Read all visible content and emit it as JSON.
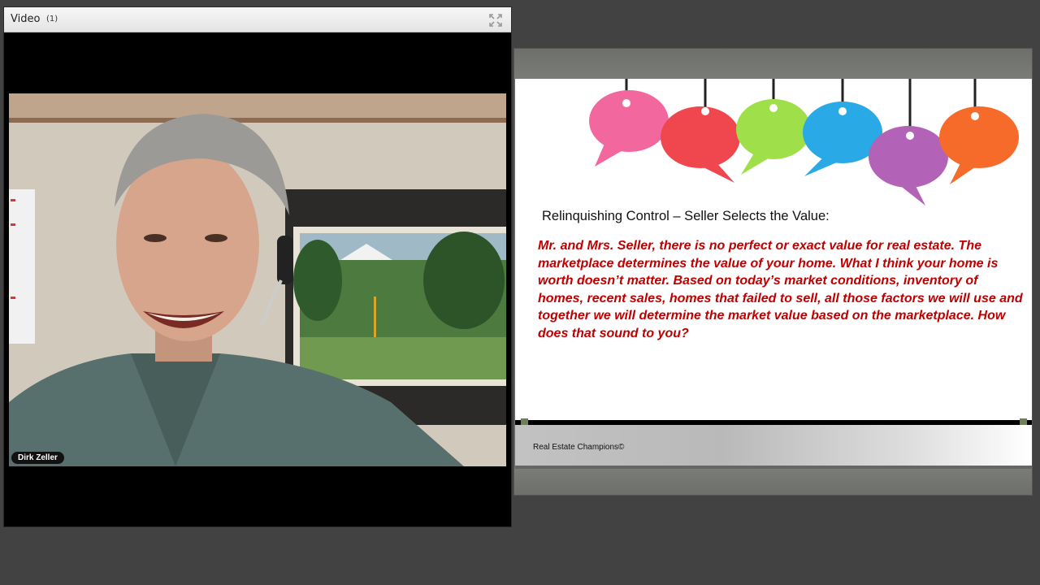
{
  "colors": {
    "background": "#424242",
    "slide_text": "#c00000"
  },
  "video_pod": {
    "title": "Video",
    "count": "(1)",
    "fullscreen_icon": "fullscreen-icon",
    "participant_name": "Dirk Zeller"
  },
  "slide": {
    "heading": "Relinquishing Control – Seller Selects the Value:",
    "body": "Mr. and Mrs. Seller, there is no perfect or exact value for real estate. The marketplace determines the value of your home. What I think your home is worth doesn’t matter. Based on today’s market conditions, inventory of homes, recent sales, homes that failed to sell, all those factors we will use and together we will determine the market value based on the marketplace. How does that sound to you?",
    "footer": "Real Estate Champions©",
    "balloon_colors": [
      "#f2679e",
      "#f0474f",
      "#9fe04a",
      "#29a9e6",
      "#b262b7",
      "#f76b2a"
    ]
  }
}
